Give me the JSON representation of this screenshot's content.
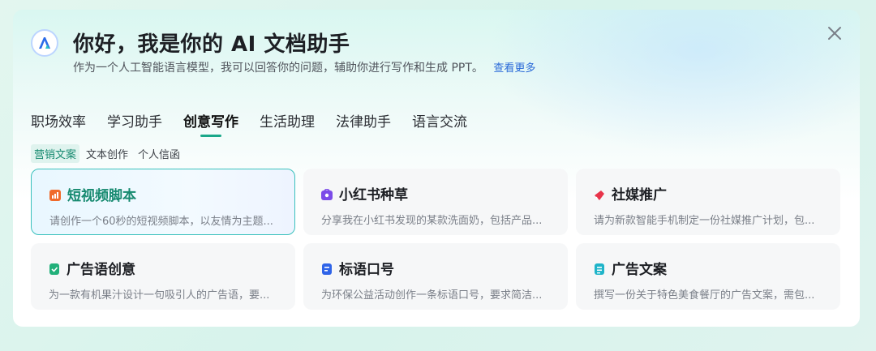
{
  "header": {
    "title": "你好，我是你的 AI 文档助手",
    "subtitle": "作为一个人工智能语言模型，我可以回答你的问题，辅助你进行写作和生成 PPT。",
    "more_link": "查看更多"
  },
  "tabs": [
    {
      "label": "职场效率"
    },
    {
      "label": "学习助手"
    },
    {
      "label": "创意写作"
    },
    {
      "label": "生活助理"
    },
    {
      "label": "法律助手"
    },
    {
      "label": "语言交流"
    }
  ],
  "subtabs": [
    {
      "label": "营销文案"
    },
    {
      "label": "文本创作"
    },
    {
      "label": "个人信函"
    }
  ],
  "cards": [
    {
      "title": "短视频脚本",
      "desc": "请创作一个60秒的短视频脚本，以友情为主题...",
      "icon": "chart-doc-icon",
      "color": "#f06a2b"
    },
    {
      "title": "小红书种草",
      "desc": "分享我在小红书发现的某款洗面奶，包括产品...",
      "icon": "bag-icon",
      "color": "#7b4be8"
    },
    {
      "title": "社媒推广",
      "desc": "请为新款智能手机制定一份社媒推广计划，包...",
      "icon": "megaphone-icon",
      "color": "#e8344a"
    },
    {
      "title": "广告语创意",
      "desc": "为一款有机果汁设计一句吸引人的广告语，要...",
      "icon": "check-doc-icon",
      "color": "#22b07a"
    },
    {
      "title": "标语口号",
      "desc": "为环保公益活动创作一条标语口号，要求简洁...",
      "icon": "doc-icon",
      "color": "#2f64e8"
    },
    {
      "title": "广告文案",
      "desc": "撰写一份关于特色美食餐厅的广告文案，需包...",
      "icon": "text-doc-icon",
      "color": "#1fb4c9"
    }
  ]
}
